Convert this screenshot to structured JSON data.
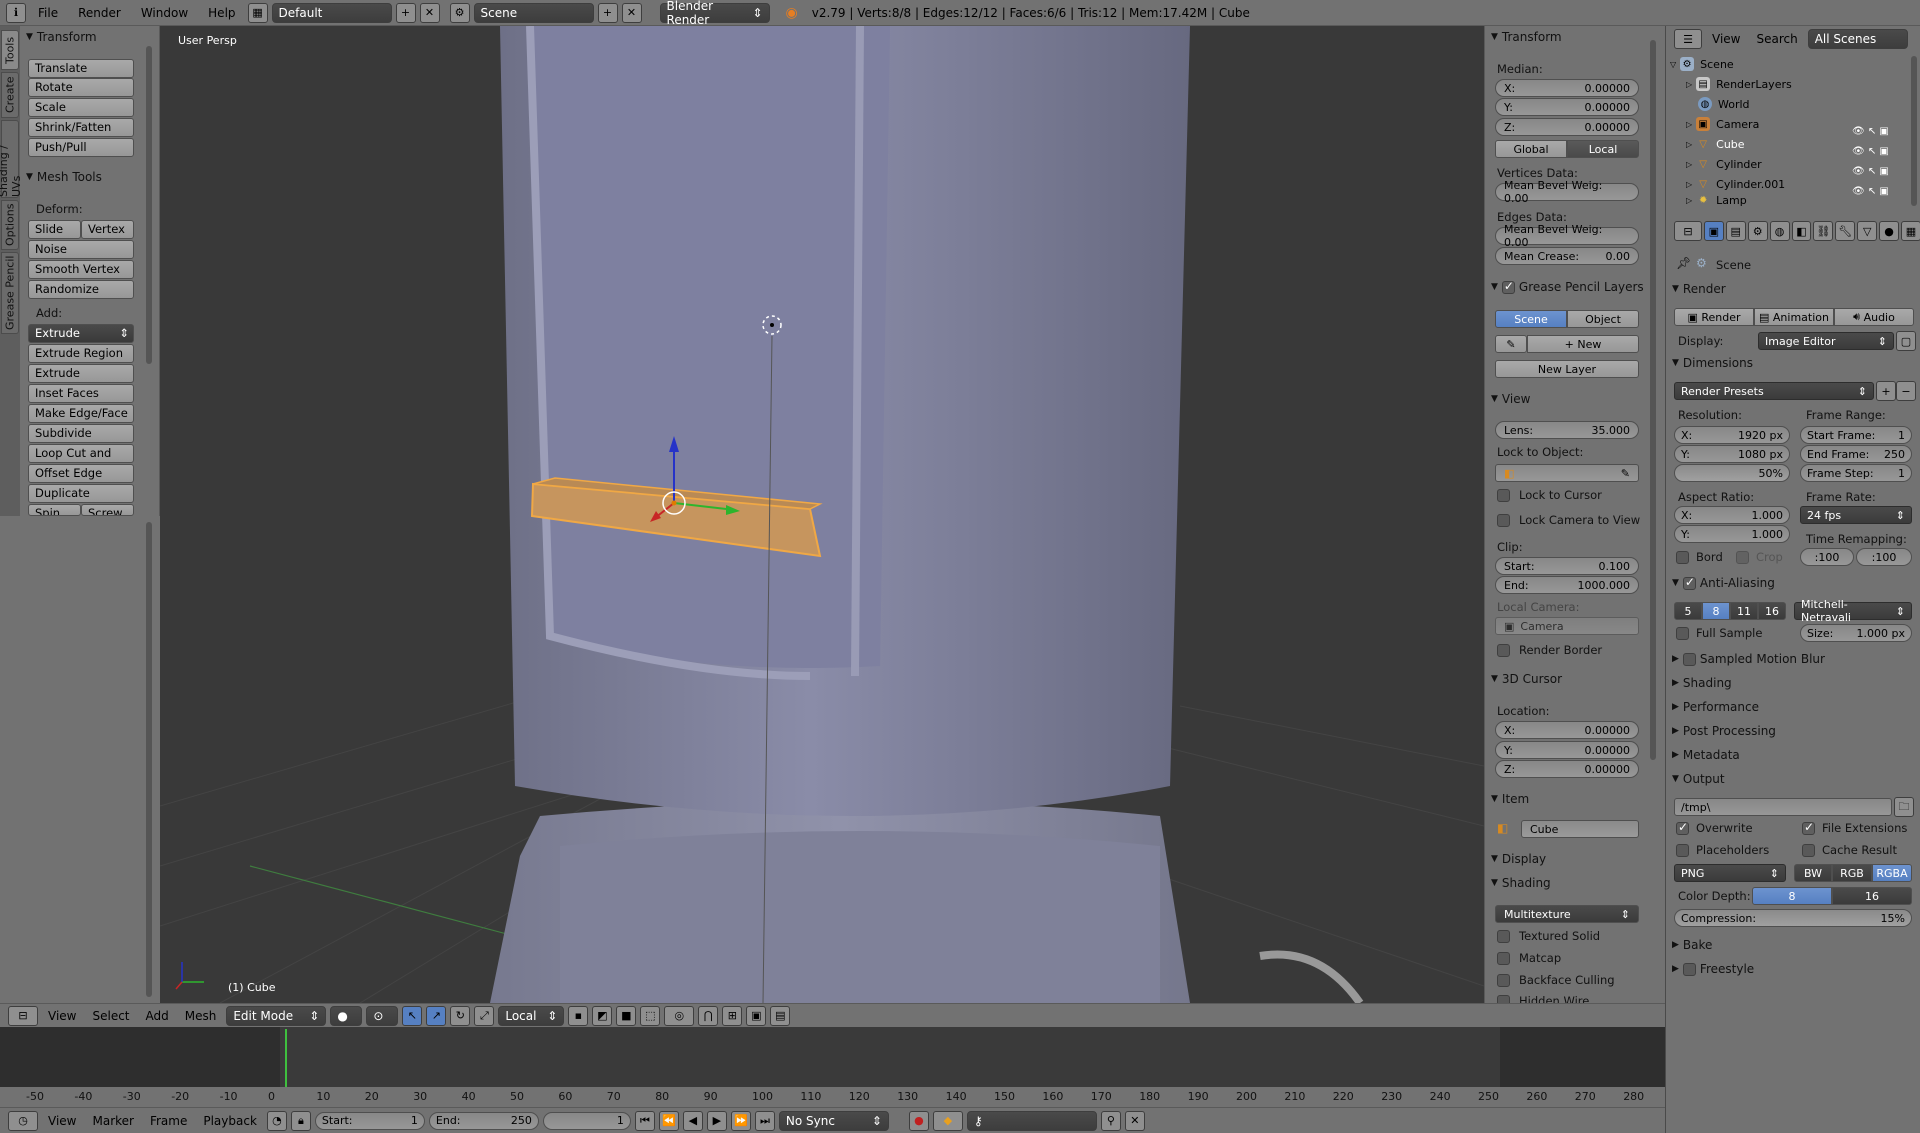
{
  "topbar": {
    "menus": [
      "File",
      "Render",
      "Window",
      "Help"
    ],
    "screen_layout": "Default",
    "scene": "Scene",
    "engine": "Blender Render",
    "stats": "v2.79 | Verts:8/8 | Edges:12/12 | Faces:6/6 | Tris:12 | Mem:17.42M | Cube"
  },
  "left_tabs": [
    "Tools",
    "Create",
    "Shading / UVs",
    "Options",
    "Grease Pencil"
  ],
  "tools": {
    "transform_header": "Transform",
    "transform_buttons": [
      "Translate",
      "Rotate",
      "Scale",
      "Shrink/Fatten",
      "Push/Pull"
    ],
    "mesh_tools_header": "Mesh Tools",
    "deform_label": "Deform:",
    "slide_edge": "Slide Ed",
    "vertex": "Vertex",
    "deform_buttons": [
      "Noise",
      "Smooth Vertex",
      "Randomize"
    ],
    "add_label": "Add:",
    "extrude": "Extrude",
    "add_buttons": [
      "Extrude Region",
      "Extrude Individual",
      "Inset Faces",
      "Make Edge/Face",
      "Subdivide",
      "Loop Cut and Slide",
      "Offset Edge Slide",
      "Duplicate"
    ],
    "spin": "Spin",
    "screw": "Screw"
  },
  "viewport": {
    "view_label": "User Persp",
    "object_label": "(1) Cube"
  },
  "view3d_header": {
    "menus": [
      "View",
      "Select",
      "Add",
      "Mesh"
    ],
    "mode": "Edit Mode",
    "orientation": "Local"
  },
  "npanel": {
    "transform_header": "Transform",
    "median_label": "Median:",
    "median": [
      {
        "axis": "X:",
        "value": "0.00000"
      },
      {
        "axis": "Y:",
        "value": "0.00000"
      },
      {
        "axis": "Z:",
        "value": "0.00000"
      }
    ],
    "global": "Global",
    "local": "Local",
    "vertices_data": "Vertices Data:",
    "mean_bevel_vert": "Mean Bevel Weig: 0.00",
    "edges_data": "Edges Data:",
    "mean_bevel_edge": "Mean Bevel Weig: 0.00",
    "mean_crease": "Mean Crease:",
    "mean_crease_value": "0.00",
    "gp_header": "Grease Pencil Layers",
    "scene_btn": "Scene",
    "object_btn": "Object",
    "new_btn": "New",
    "new_layer": "New Layer",
    "view_header": "View",
    "lens": "Lens:",
    "lens_value": "35.000",
    "lock_to_object": "Lock to Object:",
    "lock_to_cursor": "Lock to Cursor",
    "lock_camera": "Lock Camera to View",
    "clip": "Clip:",
    "clip_start": "Start:",
    "clip_start_value": "0.100",
    "clip_end": "End:",
    "clip_end_value": "1000.000",
    "local_camera": "Local Camera:",
    "camera": "Camera",
    "render_border": "Render Border",
    "cursor_header": "3D Cursor",
    "location": "Location:",
    "cursor": [
      {
        "axis": "X:",
        "value": "0.00000"
      },
      {
        "axis": "Y:",
        "value": "0.00000"
      },
      {
        "axis": "Z:",
        "value": "0.00000"
      }
    ],
    "item_header": "Item",
    "item_name": "Cube",
    "display_header": "Display",
    "shading_header": "Shading",
    "shading_mode": "Multitexture",
    "textured_solid": "Textured Solid",
    "matcap": "Matcap",
    "backface": "Backface Culling",
    "hidden_wire": "Hidden Wire"
  },
  "outliner": {
    "menus": [
      "View",
      "Search"
    ],
    "filter": "All Scenes",
    "items": [
      "Scene",
      "RenderLayers",
      "World",
      "Camera",
      "Cube",
      "Cylinder",
      "Cylinder.001",
      "Lamp"
    ]
  },
  "properties": {
    "context": "Scene",
    "render_header": "Render",
    "render_btn": "Render",
    "animation_btn": "Animation",
    "audio_btn": "Audio",
    "display_label": "Display:",
    "display_value": "Image Editor",
    "dimensions_header": "Dimensions",
    "render_presets": "Render Presets",
    "resolution_label": "Resolution:",
    "res_x": "1920 px",
    "res_y": "1080 px",
    "res_pct": "50%",
    "frame_range_label": "Frame Range:",
    "start_frame": "Start Frame:",
    "start_frame_value": "1",
    "end_frame": "End Frame:",
    "end_frame_value": "250",
    "frame_step": "Frame Step:",
    "frame_step_value": "1",
    "aspect_label": "Aspect Ratio:",
    "aspect_x": "1.000",
    "aspect_y": "1.000",
    "frame_rate_label": "Frame Rate:",
    "frame_rate": "24 fps",
    "time_remap_label": "Time Remapping:",
    "remap_old": ":100",
    "remap_new": ":100",
    "bord": "Bord",
    "crop": "Crop",
    "aa_header": "Anti-Aliasing",
    "aa_samples": [
      "5",
      "8",
      "11",
      "16"
    ],
    "aa_filter": "Mitchell-Netravali",
    "full_sample": "Full Sample",
    "aa_size": "Size:",
    "aa_size_value": "1.000 px",
    "collapsed": [
      "Sampled Motion Blur",
      "Shading",
      "Performance",
      "Post Processing",
      "Metadata"
    ],
    "output_header": "Output",
    "output_path": "/tmp\\",
    "overwrite": "Overwrite",
    "file_ext": "File Extensions",
    "placeholders": "Placeholders",
    "cache_result": "Cache Result",
    "format": "PNG",
    "bw": "BW",
    "rgb": "RGB",
    "rgba": "RGBA",
    "color_depth": "Color Depth:",
    "depth8": "8",
    "depth16": "16",
    "compression": "Compression:",
    "compression_value": "15%",
    "bake": "Bake",
    "freestyle": "Freestyle"
  },
  "timeline": {
    "ticks": [
      "-50",
      "-40",
      "-30",
      "-20",
      "-10",
      "0",
      "10",
      "20",
      "30",
      "40",
      "50",
      "60",
      "70",
      "80",
      "90",
      "100",
      "110",
      "120",
      "130",
      "140",
      "150",
      "160",
      "170",
      "180",
      "190",
      "200",
      "210",
      "220",
      "230",
      "240",
      "250",
      "260",
      "270",
      "280"
    ],
    "menus": [
      "View",
      "Marker",
      "Frame",
      "Playback"
    ],
    "start_label": "Start:",
    "start_value": "1",
    "end_label": "End:",
    "end_value": "250",
    "current": "1",
    "sync": "No Sync"
  },
  "colors": {
    "accent": "#5680c2",
    "selection": "#e8a75a",
    "bg": "#727272",
    "viewport": "#393939"
  }
}
